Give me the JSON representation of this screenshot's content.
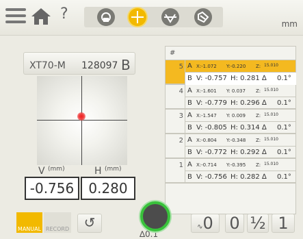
{
  "header": {
    "help_label": "?",
    "units": "mm",
    "icons": [
      "menu-icon",
      "home-icon",
      "help-icon",
      "measure-mode-icon",
      "target-mode-icon",
      "level-mode-icon",
      "tolerance-mode-icon"
    ]
  },
  "device": {
    "model": "XT70-M",
    "serial": "128097",
    "side": "B"
  },
  "target": {
    "resolution": "0.1"
  },
  "readings": {
    "v_label": "V",
    "h_label": "H",
    "unit": "(mm)",
    "v_value": "-0.756",
    "h_value": "0.280"
  },
  "controls": {
    "manual_label": "MANUAL",
    "record_label": "RECORD",
    "undo": "↺",
    "zero": "0",
    "half": "½",
    "one": "1"
  },
  "table": {
    "header": "#",
    "rows": [
      {
        "n": "5",
        "selected": true,
        "a": {
          "x": "X:-1.072",
          "y": "Y:-0.220",
          "z": "Z:",
          "z_val": "15.010"
        },
        "b": {
          "v": "V: -0.757",
          "h": "H: 0.281",
          "res": "0.1°"
        }
      },
      {
        "n": "4",
        "selected": false,
        "a": {
          "x": "X:-1.601",
          "y": "Y: 0.037",
          "z": "Z:",
          "z_val": "15.010"
        },
        "b": {
          "v": "V: -0.779",
          "h": "H: 0.296",
          "res": "0.1°"
        }
      },
      {
        "n": "3",
        "selected": false,
        "a": {
          "x": "X:-1.547",
          "y": "Y: 0.009",
          "z": "Z:",
          "z_val": "15.010"
        },
        "b": {
          "v": "V: -0.805",
          "h": "H: 0.314",
          "res": "0.1°"
        }
      },
      {
        "n": "2",
        "selected": false,
        "a": {
          "x": "X:-0.804",
          "y": "Y:-0.348",
          "z": "Z:",
          "z_val": "15.010"
        },
        "b": {
          "v": "V: -0.772",
          "h": "H: 0.292",
          "res": "0.1°"
        }
      },
      {
        "n": "1",
        "selected": false,
        "a": {
          "x": "X:-0.714",
          "y": "Y:-0.395",
          "z": "Z:",
          "z_val": "15.010"
        },
        "b": {
          "v": "V: -0.756",
          "h": "H: 0.282",
          "res": "0.1°"
        }
      }
    ]
  },
  "colors": {
    "accent": "#f2b900",
    "measure_ring": "#39c23b",
    "background": "#ecebe3"
  }
}
